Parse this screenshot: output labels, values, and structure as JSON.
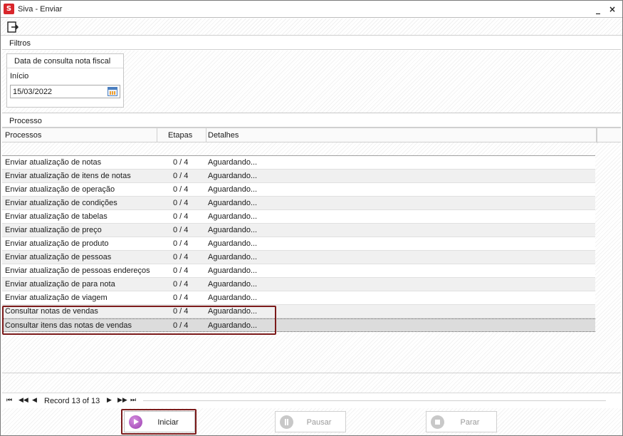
{
  "window": {
    "title": "Siva - Enviar",
    "minimize_label": "_",
    "close_label": "×"
  },
  "toolbar": {
    "exit_icon": "exit-icon"
  },
  "filtros": {
    "header": "Filtros",
    "box_title": "Data de consulta nota fiscal",
    "inicio_label": "Início",
    "inicio_value": "15/03/2022"
  },
  "processo": {
    "header": "Processo",
    "columns": [
      "Processos",
      "Etapas",
      "Detalhes"
    ],
    "rows": [
      {
        "processo": "Enviar atualização de notas",
        "etapas": "0 / 4",
        "detalhes": "Aguardando..."
      },
      {
        "processo": "Enviar atualização de itens de notas",
        "etapas": "0 / 4",
        "detalhes": "Aguardando..."
      },
      {
        "processo": "Enviar atualização de operação",
        "etapas": "0 / 4",
        "detalhes": "Aguardando..."
      },
      {
        "processo": "Enviar atualização de condições",
        "etapas": "0 / 4",
        "detalhes": "Aguardando..."
      },
      {
        "processo": "Enviar atualização de tabelas",
        "etapas": "0 / 4",
        "detalhes": "Aguardando..."
      },
      {
        "processo": "Enviar atualização de preço",
        "etapas": "0 / 4",
        "detalhes": "Aguardando..."
      },
      {
        "processo": "Enviar atualização de produto",
        "etapas": "0 / 4",
        "detalhes": "Aguardando..."
      },
      {
        "processo": "Enviar atualização de pessoas",
        "etapas": "0 / 4",
        "detalhes": "Aguardando..."
      },
      {
        "processo": "Enviar atualização de pessoas endereços",
        "etapas": "0 / 4",
        "detalhes": "Aguardando..."
      },
      {
        "processo": "Enviar atualização de para nota",
        "etapas": "0 / 4",
        "detalhes": "Aguardando..."
      },
      {
        "processo": "Enviar atualização de viagem",
        "etapas": "0 / 4",
        "detalhes": "Aguardando..."
      },
      {
        "processo": "Consultar notas de vendas",
        "etapas": "0 / 4",
        "detalhes": "Aguardando..."
      },
      {
        "processo": "Consultar itens das notas de vendas",
        "etapas": "0 / 4",
        "detalhes": "Aguardando..."
      }
    ],
    "selected_row": 12
  },
  "navigator": {
    "first": "⏮",
    "prev_page": "◀◀",
    "prev": "◀",
    "record_text": "Record 13 of 13",
    "next": "▶",
    "next_page": "▶▶",
    "last": "⏭"
  },
  "buttons": {
    "iniciar": "Iniciar",
    "pausar": "Pausar",
    "parar": "Parar"
  },
  "colors": {
    "highlight_border": "#7b1a1a",
    "iniciar_icon": "#9b3fb0",
    "app_icon": "#d9262b"
  }
}
